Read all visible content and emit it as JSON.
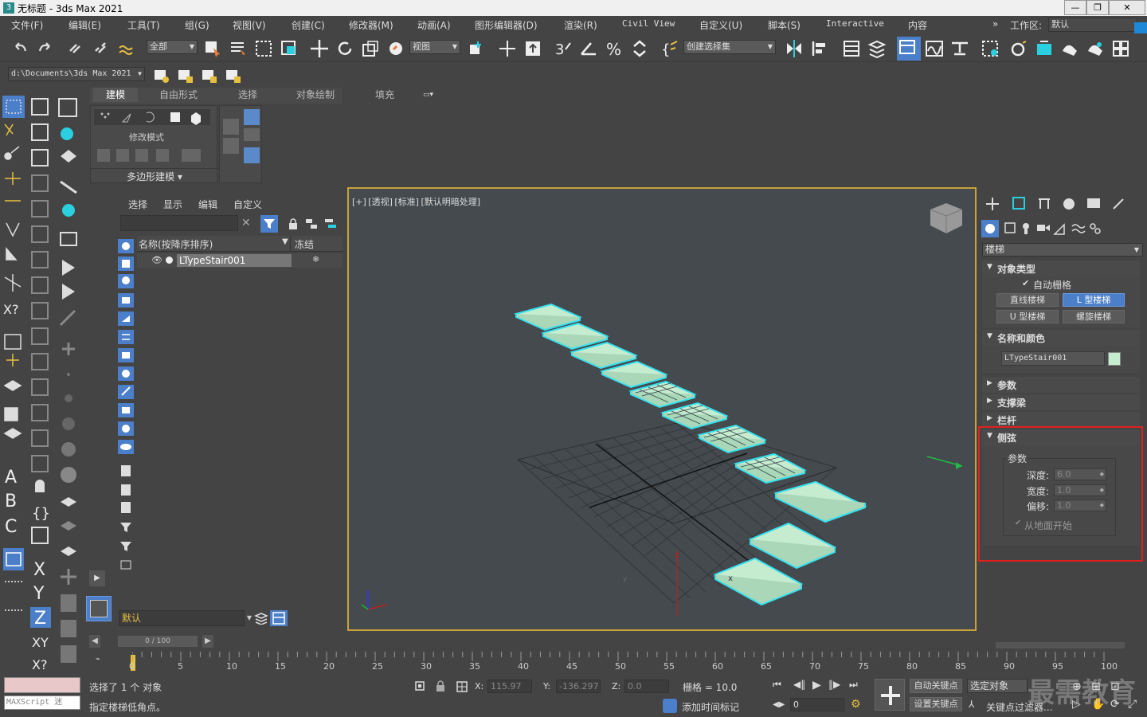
{
  "window": {
    "title": "无标题 - 3ds Max 2021",
    "logo": "3",
    "min": "—",
    "max": "❐",
    "close": "✕"
  },
  "menu": [
    "文件(F)",
    "编辑(E)",
    "工具(T)",
    "组(G)",
    "视图(V)",
    "创建(C)",
    "修改器(M)",
    "动画(A)",
    "图形编辑器(D)",
    "渲染(R)",
    "Civil View",
    "自定义(U)",
    "脚本(S)",
    "Interactive",
    "内容"
  ],
  "workspace": {
    "label": "工作区:",
    "value": "默认",
    "chev": "»"
  },
  "toolbar": {
    "filter": "全部",
    "refcoord": "视图",
    "selset": "创建选择集"
  },
  "path": "d:\\Documents\\3ds Max 2021",
  "ribbon": {
    "tabs": [
      "建模",
      "自由形式",
      "选择",
      "对象绘制",
      "填充"
    ],
    "mode_label": "修改模式",
    "poly_label": "多边形建模"
  },
  "explorer": {
    "tabs": [
      "选择",
      "显示",
      "编辑",
      "自定义"
    ],
    "col_name": "名称(按降序排序)",
    "col_freeze": "冻结",
    "items": [
      {
        "name": "LTypeStair001"
      }
    ],
    "layer": "默认"
  },
  "viewport": {
    "label": "[+] [透视] [标准] [默认明暗处理]",
    "axis_x": "x",
    "axis_y": "y",
    "axis_z": "z"
  },
  "panel": {
    "category": "楼梯",
    "object_type": {
      "title": "对象类型",
      "autogrid": "自动栅格",
      "buttons": [
        "直线楼梯",
        "L 型楼梯",
        "U 型楼梯",
        "螺旋楼梯"
      ],
      "active": 1
    },
    "name_color": {
      "title": "名称和颜色",
      "name": "LTypeStair001",
      "color": "#c6ecd0"
    },
    "rollouts": [
      "参数",
      "支撑梁",
      "栏杆"
    ],
    "stringers": {
      "title": "侧弦",
      "group": "参数",
      "fields": [
        {
          "label": "深度:",
          "value": "6.0"
        },
        {
          "label": "宽度:",
          "value": "1.0"
        },
        {
          "label": "偏移:",
          "value": "1.0"
        }
      ],
      "from_floor": "从地面开始"
    }
  },
  "timeline": {
    "range": "0 / 100",
    "ticks": [
      "0",
      "5",
      "10",
      "15",
      "20",
      "25",
      "30",
      "35",
      "40",
      "45",
      "50",
      "55",
      "60",
      "65",
      "70",
      "75",
      "80",
      "85",
      "90",
      "95",
      "100"
    ]
  },
  "status": {
    "selected": "选择了 1 个 对象",
    "prompt": "指定楼梯低角点。",
    "x_label": "X:",
    "x": "115.97",
    "y_label": "Y:",
    "y": "-136.297",
    "z_label": "Z:",
    "z": "0.0",
    "grid": "栅格 = 10.0",
    "add_time_tag": "添加时间标记",
    "frame": "0",
    "auto_key": "自动关键点",
    "set_key": "设置关键点",
    "selected_obj": "选定对象",
    "key_filter": "关键点过滤器...",
    "maxscript": "MAXScript 迷"
  },
  "watermark": "最需教育",
  "colors": {
    "accent": "#4c7fc9",
    "highlight_box": "#e02020",
    "viewport_border": "#c8a23a",
    "stair_fill": "#c6ecd0",
    "stair_edge": "#36e0ef"
  }
}
